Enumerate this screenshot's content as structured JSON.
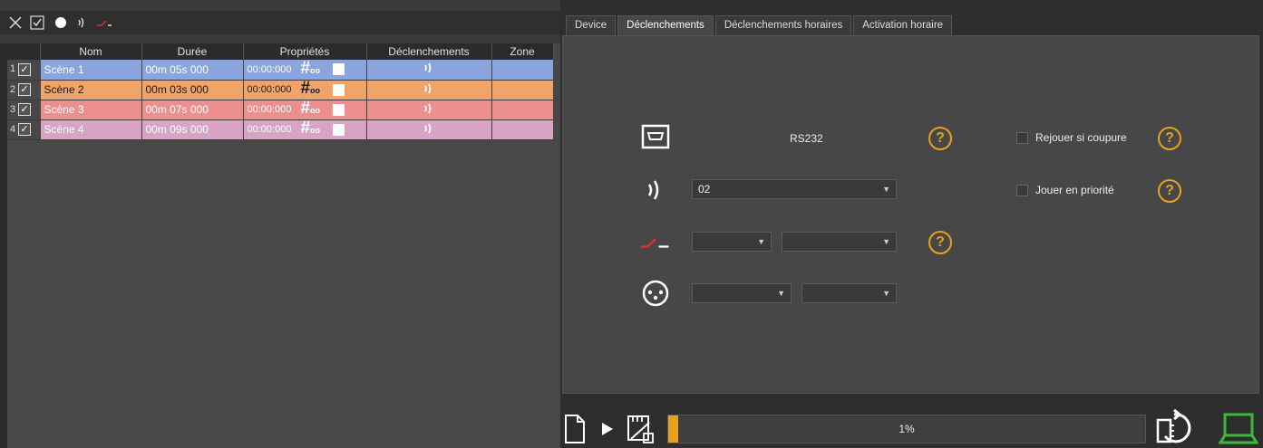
{
  "toolbar": {
    "icons": [
      "close-icon",
      "checkbox-icon",
      "record-icon",
      "wireless-trigger-icon",
      "switch-contact-icon"
    ]
  },
  "table": {
    "headers": [
      "Nom",
      "Durée",
      "Propriétés",
      "Déclenchements",
      "Zone"
    ],
    "rows": [
      {
        "num": "1",
        "checked": "✓",
        "name": "Scène 1",
        "duration": "00m 05s 000",
        "time": "00:00:000",
        "hash_sub": "oo",
        "color": "#8aa4e0",
        "text_color": "#ffffff"
      },
      {
        "num": "2",
        "checked": "✓",
        "name": "Scène 2",
        "duration": "00m 03s 000",
        "time": "00:00:000",
        "hash_sub": "oo",
        "color": "#f0a46a",
        "text_color": "#1a1a1a"
      },
      {
        "num": "3",
        "checked": "✓",
        "name": "Scène 3",
        "duration": "00m 07s 000",
        "time": "00:00:000",
        "hash_sub": "oo",
        "color": "#ec8f8f",
        "text_color": "#ffffff"
      },
      {
        "num": "4",
        "checked": "✓",
        "name": "Scène 4",
        "duration": "00m 09s 000",
        "time": "00:00:000",
        "hash_sub": "oo",
        "color": "#d8a4c4",
        "text_color": "#ffffff"
      }
    ]
  },
  "tabs": [
    "Device",
    "Déclenchements",
    "Déclenchements horaires",
    "Activation horaire"
  ],
  "active_tab": "Déclenchements",
  "triggers": {
    "rs232_label": "RS232",
    "radio_value": "02",
    "replay_label": "Rejouer si coupure",
    "priority_label": "Jouer en priorité",
    "help_symbol": "?"
  },
  "progress": {
    "value": 0.01,
    "label": "1%"
  },
  "colors": {
    "accent": "#e8a020",
    "green": "#3db83d"
  }
}
